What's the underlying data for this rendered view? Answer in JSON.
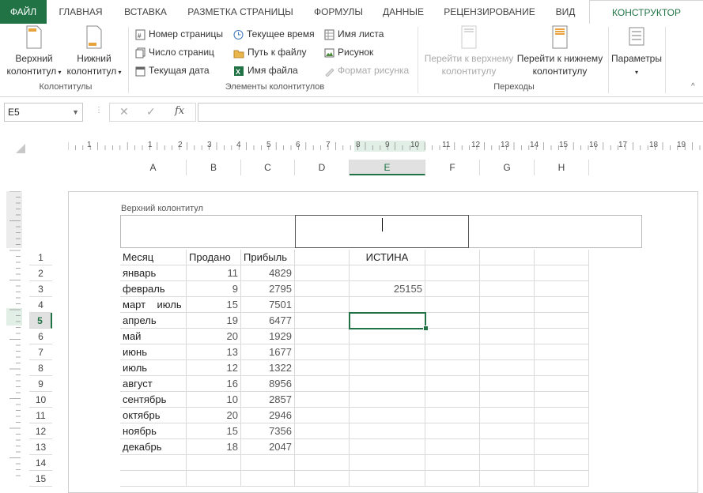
{
  "tabs": [
    "ФАЙЛ",
    "ГЛАВНАЯ",
    "ВСТАВКА",
    "РАЗМЕТКА СТРАНИЦЫ",
    "ФОРМУЛЫ",
    "ДАННЫЕ",
    "РЕЦЕНЗИРОВАНИЕ",
    "ВИД",
    "КОНСТРУКТОР"
  ],
  "ribbon": {
    "header_btn": [
      "Верхний",
      "колонтитул"
    ],
    "footer_btn": [
      "Нижний",
      "колонтитул"
    ],
    "group_hf": "Колонтитулы",
    "elements": [
      "Номер страницы",
      "Текущее время",
      "Имя листа",
      "Число страниц",
      "Путь к файлу",
      "Рисунок",
      "Текущая дата",
      "Имя файла",
      "Формат рисунка"
    ],
    "group_elements": "Элементы колонтитулов",
    "goto_header": [
      "Перейти к верхнему",
      "колонтитулу"
    ],
    "goto_footer": [
      "Перейти к нижнему",
      "колонтитулу"
    ],
    "group_nav": "Переходы",
    "params": "Параметры"
  },
  "formula_bar": {
    "name_box": "E5",
    "cancel": "✕",
    "enter": "✓",
    "fx": "fx",
    "content": ""
  },
  "h_ruler": [
    "1",
    "1",
    "2",
    "3",
    "4",
    "5",
    "6",
    "7",
    "8",
    "9",
    "10",
    "11",
    "12",
    "13",
    "14",
    "15",
    "16",
    "17",
    "18",
    "19"
  ],
  "columns": [
    "A",
    "B",
    "C",
    "D",
    "E",
    "F",
    "G",
    "H"
  ],
  "page_header_label": "Верхний колонтитул",
  "rows": [
    "1",
    "2",
    "3",
    "4",
    "5",
    "6",
    "7",
    "8",
    "9",
    "10",
    "11",
    "12",
    "13",
    "14",
    "15"
  ],
  "table": {
    "headers": [
      "Месяц",
      "Продано",
      "Прибыль"
    ],
    "data": [
      [
        "январь",
        "11",
        "4829"
      ],
      [
        "февраль",
        "9",
        "2795"
      ],
      [
        "март    июль",
        "15",
        "7501"
      ],
      [
        "апрель",
        "19",
        "6477"
      ],
      [
        "май",
        "20",
        "1929"
      ],
      [
        "июнь",
        "13",
        "1677"
      ],
      [
        "июль",
        "12",
        "1322"
      ],
      [
        "август",
        "16",
        "8956"
      ],
      [
        "сентябрь",
        "10",
        "2857"
      ],
      [
        "октябрь",
        "20",
        "2946"
      ],
      [
        "ноябрь",
        "15",
        "7356"
      ],
      [
        "декабрь",
        "18",
        "2047"
      ]
    ]
  },
  "e1": "ИСТИНА",
  "e3": "25155",
  "colors": {
    "accent": "#217346",
    "selected_header": "#e1e1e1"
  }
}
